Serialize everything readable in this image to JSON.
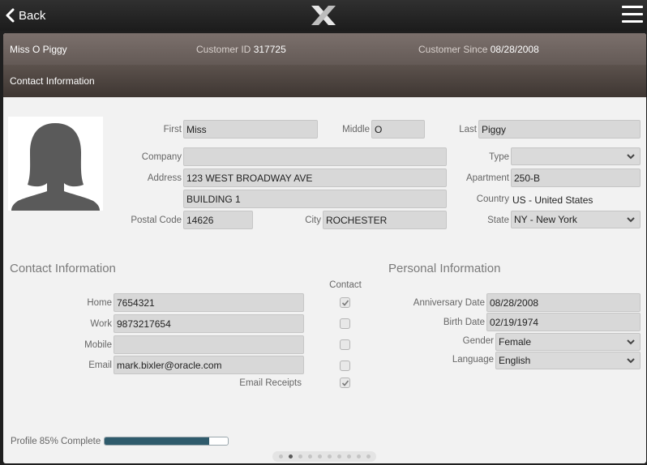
{
  "nav": {
    "back_label": "Back"
  },
  "customer": {
    "name": "Miss O Piggy",
    "id_label": "Customer ID",
    "id_value": "317725",
    "since_label": "Customer Since",
    "since_value": "08/28/2008"
  },
  "section_title": "Contact Information",
  "form": {
    "first_label": "First",
    "first_value": "Miss",
    "middle_label": "Middle",
    "middle_value": "O",
    "last_label": "Last",
    "last_value": "Piggy",
    "company_label": "Company",
    "company_value": "",
    "type_label": "Type",
    "type_value": "",
    "address_label": "Address",
    "address1_value": "123 WEST BROADWAY AVE",
    "address2_value": "BUILDING 1",
    "apartment_label": "Apartment",
    "apartment_value": "250-B",
    "country_label": "Country",
    "country_value": "US - United States",
    "postal_label": "Postal Code",
    "postal_value": "14626",
    "city_label": "City",
    "city_value": "ROCHESTER",
    "state_label": "State",
    "state_value": "NY - New York"
  },
  "contact": {
    "heading": "Contact Information",
    "contact_col_label": "Contact",
    "home_label": "Home",
    "home_value": "7654321",
    "home_checked": true,
    "work_label": "Work",
    "work_value": "9873217654",
    "work_checked": false,
    "mobile_label": "Mobile",
    "mobile_value": "",
    "mobile_checked": false,
    "email_label": "Email",
    "email_value": "mark.bixler@oracle.com",
    "email_checked": false,
    "receipts_label": "Email Receipts",
    "receipts_checked": true
  },
  "personal": {
    "heading": "Personal Information",
    "anniversary_label": "Anniversary Date",
    "anniversary_value": "08/28/2008",
    "birth_label": "Birth Date",
    "birth_value": "02/19/1974",
    "gender_label": "Gender",
    "gender_value": "Female",
    "language_label": "Language",
    "language_value": "English"
  },
  "profile": {
    "label": "Profile 85% Complete",
    "percent": 85
  },
  "pager": {
    "count": 10,
    "active": 1
  },
  "colors": {
    "progress": "#2f5b6c",
    "header_bar": "#6e6460",
    "section_bar": "#4a413d"
  }
}
